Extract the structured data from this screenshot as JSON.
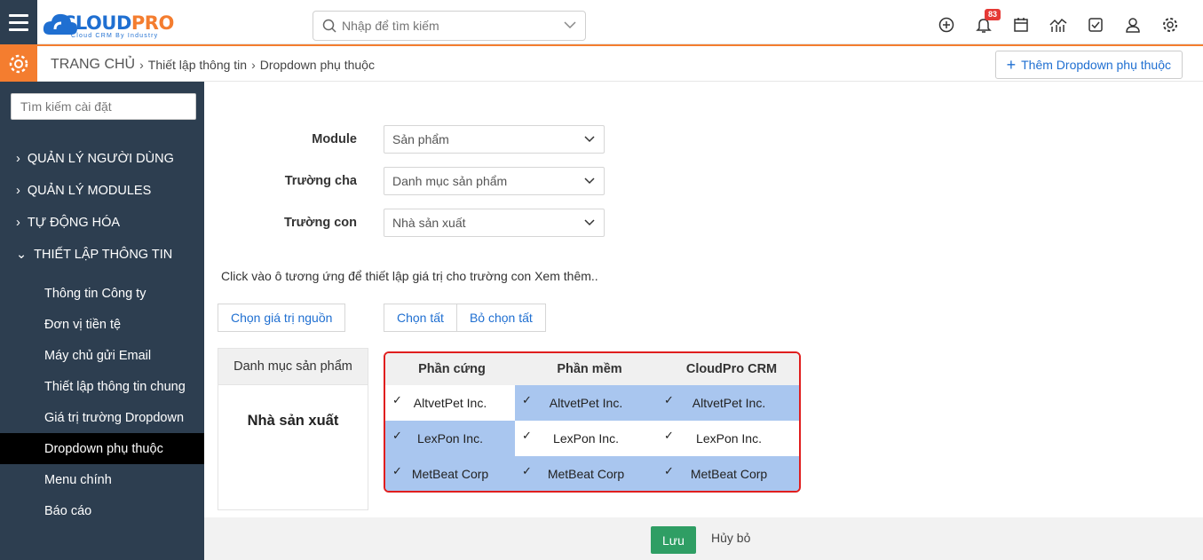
{
  "app": {
    "logo_main": "CLOUD",
    "logo_accent": "PRO",
    "logo_sub": "Cloud CRM By Industry"
  },
  "search": {
    "placeholder": "Nhập để tìm kiếm"
  },
  "notifications": {
    "count": "83"
  },
  "breadcrumb": {
    "home": "TRANG CHỦ",
    "level1": "Thiết lập thông tin",
    "level2": "Dropdown phụ thuộc"
  },
  "actions": {
    "add_label": "Thêm Dropdown phụ thuộc"
  },
  "sidebar": {
    "search_placeholder": "Tìm kiếm cài đặt",
    "sections": [
      "QUẢN LÝ NGƯỜI DÙNG",
      "QUẢN LÝ MODULES",
      "TỰ ĐỘNG HÓA",
      "THIẾT LẬP THÔNG TIN"
    ],
    "items": [
      "Thông tin Công ty",
      "Đơn vị tiền tệ",
      "Máy chủ gửi Email",
      "Thiết lập thông tin chung",
      "Giá trị trường Dropdown",
      "Dropdown phụ thuộc",
      "Menu chính",
      "Báo cáo"
    ],
    "active_item": "Dropdown phụ thuộc"
  },
  "form": {
    "module_label": "Module",
    "module_value": "Sản phẩm",
    "parent_label": "Trường cha",
    "parent_value": "Danh mục sản phẩm",
    "child_label": "Trường con",
    "child_value": "Nhà sản xuất"
  },
  "hint": "Click vào ô tương ứng để thiết lập giá trị cho trường con  Xem thêm..",
  "buttons": {
    "choose_source": "Chọn giá trị nguồn",
    "select_all": "Chọn tất",
    "deselect_all": "Bỏ chọn tất"
  },
  "source": {
    "header": "Danh mục sản phẩm",
    "value": "Nhà sản xuất"
  },
  "mapping": {
    "columns": [
      "Phần cứng",
      "Phần mềm",
      "CloudPro CRM"
    ],
    "rows": [
      [
        "AltvetPet Inc.",
        "AltvetPet Inc.",
        "AltvetPet Inc."
      ],
      [
        "LexPon Inc.",
        "LexPon Inc.",
        "LexPon Inc."
      ],
      [
        "MetBeat Corp",
        "MetBeat Corp",
        "MetBeat Corp"
      ]
    ],
    "checked": [
      [
        true,
        true,
        true
      ],
      [
        true,
        true,
        true
      ],
      [
        true,
        true,
        true
      ]
    ],
    "highlighted": [
      [
        false,
        true,
        true
      ],
      [
        true,
        false,
        false
      ],
      [
        true,
        true,
        true
      ]
    ],
    "highlight_color": "#a9c6ef",
    "border_color": "#e01e1e"
  },
  "footer": {
    "save": "Lưu",
    "cancel": "Hủy bỏ"
  },
  "colors": {
    "sidebar": "#2d3e50",
    "accent": "#f47d2f",
    "link": "#1f6fd1",
    "save": "#2f9e64"
  }
}
